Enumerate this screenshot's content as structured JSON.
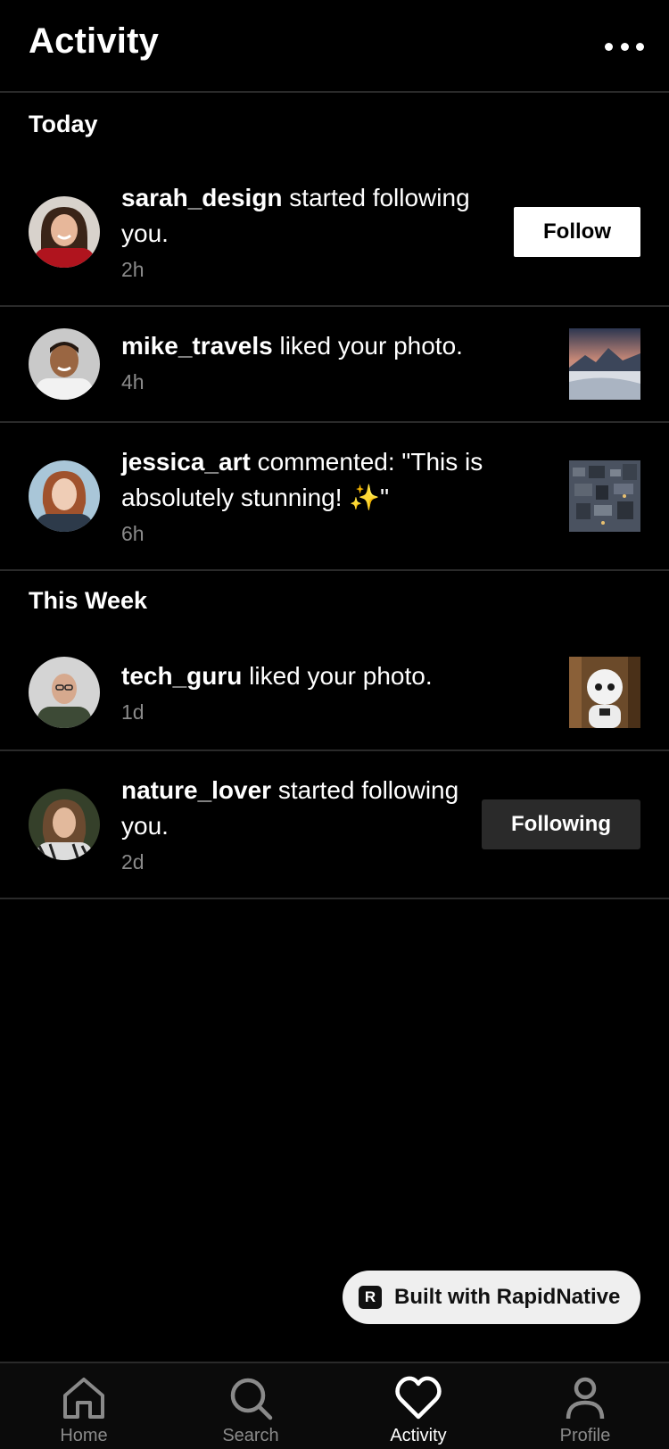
{
  "header": {
    "title": "Activity"
  },
  "sections": {
    "today": "Today",
    "this_week": "This Week"
  },
  "activities": [
    {
      "username": "sarah_design",
      "action": " started following you.",
      "time": "2h",
      "button": "Follow"
    },
    {
      "username": "mike_travels",
      "action": " liked your photo.",
      "time": "4h"
    },
    {
      "username": "jessica_art",
      "action": " commented: \"This is absolutely stunning! ✨\"",
      "time": "6h"
    },
    {
      "username": "tech_guru",
      "action": " liked your photo.",
      "time": "1d"
    },
    {
      "username": "nature_lover",
      "action": " started following you.",
      "time": "2d",
      "button": "Following"
    }
  ],
  "badge": {
    "label": "Built with RapidNative",
    "logo": "R"
  },
  "tabs": [
    {
      "label": "Home",
      "icon": "home-icon"
    },
    {
      "label": "Search",
      "icon": "search-icon"
    },
    {
      "label": "Activity",
      "icon": "heart-icon",
      "active": true
    },
    {
      "label": "Profile",
      "icon": "person-icon"
    }
  ],
  "colors": {
    "background": "#000000",
    "divider": "#2a2a2a",
    "muted_text": "#8a8a8a",
    "following_button": "#2a2a2a"
  }
}
